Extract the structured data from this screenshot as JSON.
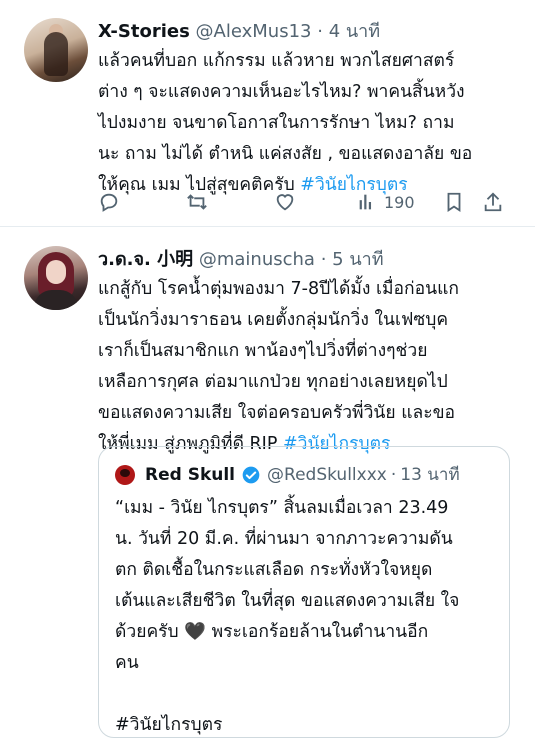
{
  "tweets": [
    {
      "author_name": "X-Stories",
      "handle": "@AlexMus13",
      "separator": "·",
      "time": "4 นาที",
      "text_lines": [
        "แล้วคนที่บอก แก้กรรม แล้วหาย พวกไสยศาสตร์",
        "ต่าง ๆ จะแสดงความเห็นอะไรไหม? พาคนสิ้นหวัง",
        "ไปงมงาย จนขาดโอกาสในการรักษา ไหม? ถาม",
        "นะ ถาม ไม่ได้ ตำหนิ แค่สงสัย ,  ขอแสดงอาลัย ขอ",
        "ให้คุณ เมม ไปสู่สุขคติครับ "
      ],
      "hashtag": "#วินัยไกรบุตร",
      "views": "190"
    },
    {
      "author_name": "ว.ด.จ. 小明",
      "handle": "@mainuscha",
      "separator": "·",
      "time": "5 นาที",
      "text_lines": [
        "แกสู้กับ โรคน้ำตุ่มพองมา 7-8ปีได้มั้ง เมื่อก่อนแก",
        "เป็นนักวิ่งมาราธอน เคยตั้งกลุ่มนักวิ่ง ในเฟซบุค",
        "เราก็เป็นสมาชิกแก พาน้องๆไปวิ่งที่ต่างๆช่วย",
        "เหลือการกุศล ต่อมาแกป่วย ทุกอย่างเลยหยุดไป",
        "ขอแสดงความเสีย ใจต่อครอบครัวพี่วินัย และขอ",
        "ให้พี่เมม สู่ภพภูมิที่ดี RIP "
      ],
      "hashtag": "#วินัยไกรบุตร",
      "quote": {
        "author_name": "Red Skull",
        "handle": "@RedSkullxxx",
        "separator": "·",
        "time": "13 นาที",
        "text_lines": [
          "“เมม - วินัย ไกรบุตร” สิ้นลมเมื่อเวลา 23.49",
          "น. วันที่ 20 มี.ค. ที่ผ่านมา จากภาวะความดัน",
          "ตก ติดเชื้อในกระแสเลือด กระทั่งหัวใจหยุด",
          "เต้นและเสียชีวิต ในที่สุด ขอแสดงความเสีย ใจ",
          "ด้วยครับ 🖤  พระเอกร้อยล้านในตำนานอีก",
          "คน"
        ],
        "hashtag": "#วินัยไกรบุตร"
      }
    }
  ],
  "colors": {
    "link": "#1d9bf0",
    "text": "#0f1419",
    "muted": "#536471",
    "border": "#cfd9de",
    "verified": "#1d9bf0"
  },
  "icons": [
    "reply-icon",
    "retweet-icon",
    "like-icon",
    "views-icon",
    "bookmark-icon",
    "share-icon",
    "verified-badge-icon"
  ]
}
